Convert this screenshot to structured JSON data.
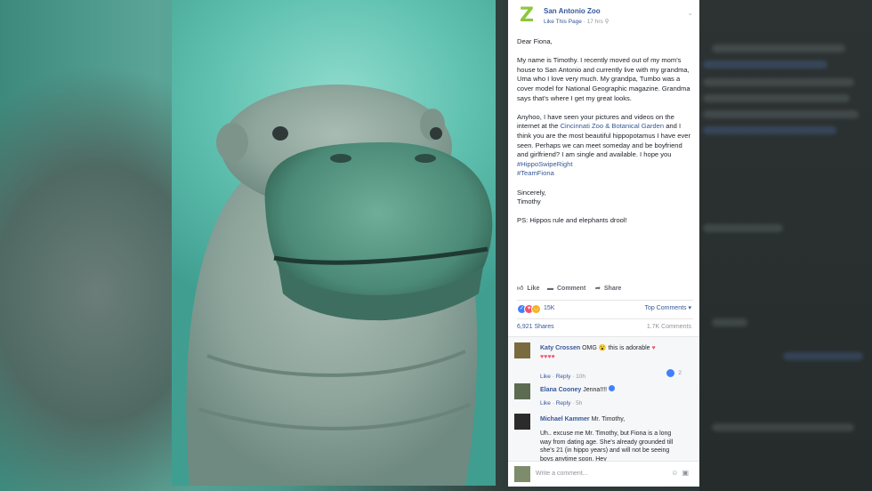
{
  "post": {
    "page_name": "San Antonio Zoo",
    "like_page": "Like This Page",
    "time": "17 hrs",
    "body": {
      "greeting": "Dear Fiona,",
      "para1": "My name is Timothy. I recently moved out of my mom's house to San Antonio and currently live with my grandma, Uma who I love very much. My grandpa, Tumbo was a cover model for National Geographic magazine. Grandma says that's where I get my great looks.",
      "para2_a": "Anyhoo, I have seen your pictures and videos on the internet at the ",
      "para2_link": "Cincinnati Zoo & Botanical Garden",
      "para2_b": " and I think you are the most beautiful hippopotamus I have ever seen. Perhaps we can meet someday and be boyfriend and girlfriend? I am single and available. I hope you ",
      "hashtag1": "#HippoSwipeRight",
      "hashtag2": "#TeamFiona",
      "closing": "Sincerely,",
      "signature": "Timothy",
      "ps": "PS: Hippos rule and elephants drool!"
    },
    "actions": {
      "like": "Like",
      "comment": "Comment",
      "share": "Share"
    },
    "reactions_count": "15K",
    "top_comments": "Top Comments",
    "shares": "6,921 Shares",
    "comments_count": "1.7K Comments"
  },
  "comments": [
    {
      "name": "Katy Crossen",
      "text": "OMG",
      "text2": "this is adorable",
      "like": "Like",
      "reply": "Reply",
      "time": "10h",
      "likes": "2"
    },
    {
      "name": "Elana Cooney",
      "text": "Jenna!!!!",
      "like": "Like",
      "reply": "Reply",
      "time": "5h"
    },
    {
      "name": "Michael Kammer",
      "text": "Mr. Timothy,",
      "reply_text": "Uh.. excuse me Mr. Timothy, but Fiona is a long way from dating age. She's already grounded till she's 21 (in hippo years) and will not be seeing boys anytime soon. Hey"
    }
  ],
  "write_comment": "Write a comment...",
  "colors": {
    "fb_blue": "#365899",
    "zoo_green": "#8cc63e",
    "water": "#63c3b2"
  }
}
